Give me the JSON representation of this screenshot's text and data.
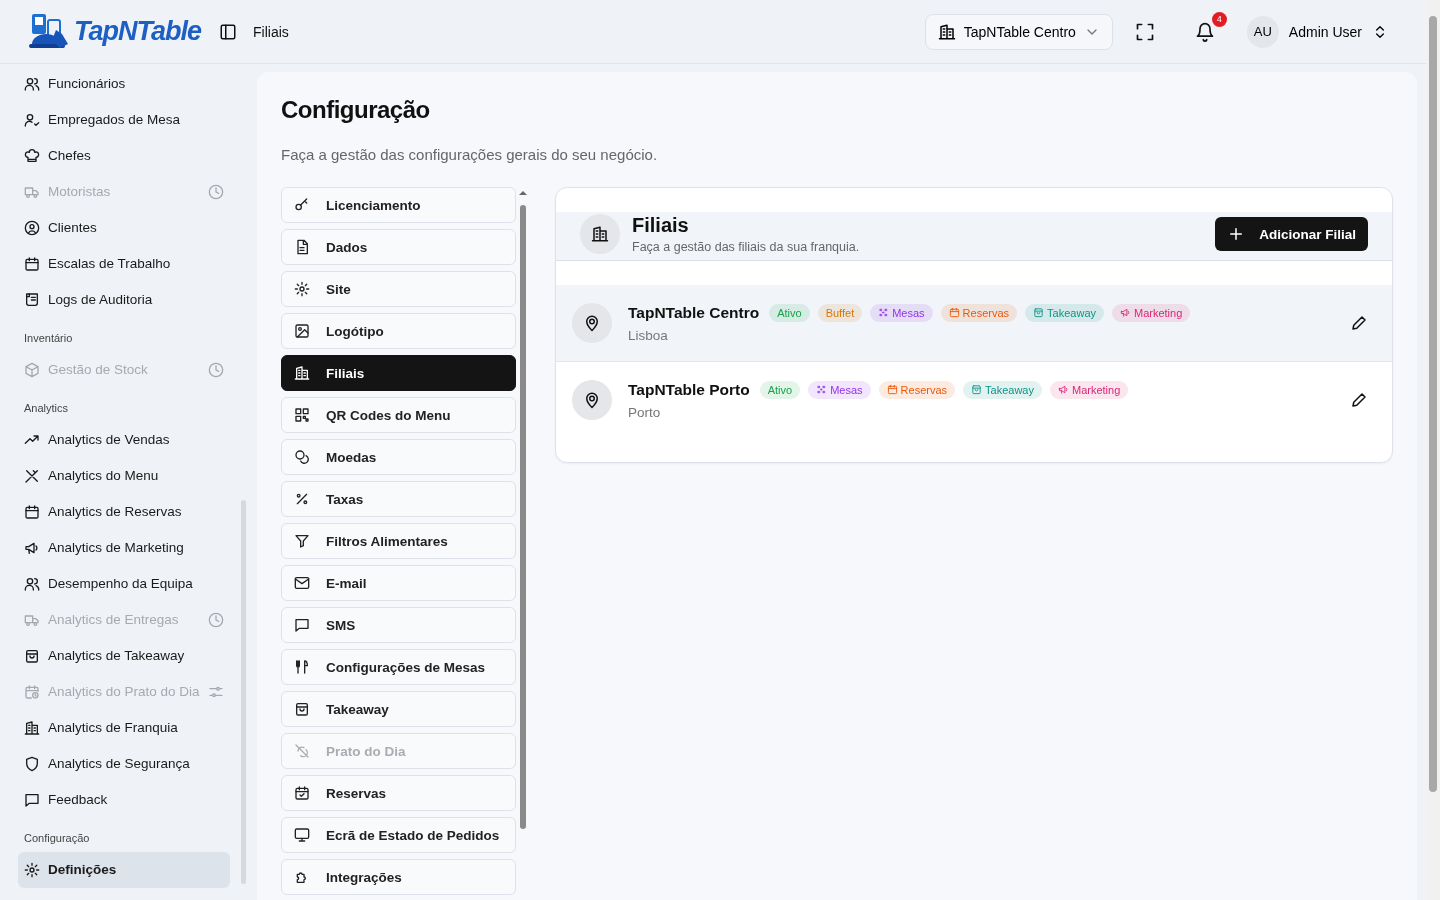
{
  "header": {
    "logo": "TapNTable",
    "page": "Filiais",
    "branch_select": {
      "value": "TapNTable Centro"
    },
    "notifications": {
      "count": "4"
    },
    "user": {
      "initials": "AU",
      "name": "Admin User"
    }
  },
  "sidebar": {
    "sections": [
      {
        "items": [
          {
            "label": "Funcionários",
            "kind": "link",
            "disabled": false,
            "selected": false
          },
          {
            "label": "Empregados de Mesa",
            "kind": "link",
            "disabled": false,
            "selected": false
          },
          {
            "label": "Chefes",
            "kind": "link",
            "disabled": false,
            "selected": false
          },
          {
            "label": "Motoristas",
            "kind": "soon",
            "disabled": true,
            "selected": false
          },
          {
            "label": "Clientes",
            "kind": "link",
            "disabled": false,
            "selected": false
          },
          {
            "label": "Escalas de Trabalho",
            "kind": "link",
            "disabled": false,
            "selected": false
          },
          {
            "label": "Logs de Auditoria",
            "kind": "link",
            "disabled": false,
            "selected": false
          }
        ]
      },
      {
        "heading": "Inventário",
        "items": [
          {
            "label": "Gestão de Stock",
            "kind": "soon",
            "disabled": true,
            "selected": false
          }
        ]
      },
      {
        "heading": "Analytics",
        "items": [
          {
            "label": "Analytics de Vendas",
            "kind": "link",
            "disabled": false,
            "selected": false
          },
          {
            "label": "Analytics do Menu",
            "kind": "link",
            "disabled": false,
            "selected": false
          },
          {
            "label": "Analytics de Reservas",
            "kind": "link",
            "disabled": false,
            "selected": false
          },
          {
            "label": "Analytics de Marketing",
            "kind": "link",
            "disabled": false,
            "selected": false
          },
          {
            "label": "Desempenho da Equipa",
            "kind": "link",
            "disabled": false,
            "selected": false
          },
          {
            "label": "Analytics de Entregas",
            "kind": "soon",
            "disabled": true,
            "selected": false
          },
          {
            "label": "Analytics de Takeaway",
            "kind": "link",
            "disabled": false,
            "selected": false
          },
          {
            "label": "Analytics do Prato do Dia",
            "kind": "setup",
            "disabled": true,
            "selected": false
          },
          {
            "label": "Analytics de Franquia",
            "kind": "link",
            "disabled": false,
            "selected": false
          },
          {
            "label": "Analytics de Segurança",
            "kind": "link",
            "disabled": false,
            "selected": false
          },
          {
            "label": "Feedback",
            "kind": "link",
            "disabled": false,
            "selected": false
          }
        ]
      },
      {
        "heading": "Configuração",
        "items": [
          {
            "label": "Definições",
            "kind": "link",
            "disabled": false,
            "selected": true
          }
        ]
      }
    ]
  },
  "page": {
    "title": "Configuração",
    "subtitle": "Faça a gestão das configurações gerais do seu negócio."
  },
  "settings_menu": [
    {
      "label": "Licenciamento",
      "selected": false,
      "disabled": false
    },
    {
      "label": "Dados",
      "selected": false,
      "disabled": false
    },
    {
      "label": "Site",
      "selected": false,
      "disabled": false
    },
    {
      "label": "Logótipo",
      "selected": false,
      "disabled": false
    },
    {
      "label": "Filiais",
      "selected": true,
      "disabled": false
    },
    {
      "label": "QR Codes do Menu",
      "selected": false,
      "disabled": false
    },
    {
      "label": "Moedas",
      "selected": false,
      "disabled": false
    },
    {
      "label": "Taxas",
      "selected": false,
      "disabled": false
    },
    {
      "label": "Filtros Alimentares",
      "selected": false,
      "disabled": false
    },
    {
      "label": "E-mail",
      "selected": false,
      "disabled": false
    },
    {
      "label": "SMS",
      "selected": false,
      "disabled": false
    },
    {
      "label": "Configurações de Mesas",
      "selected": false,
      "disabled": false
    },
    {
      "label": "Takeaway",
      "selected": false,
      "disabled": false
    },
    {
      "label": "Prato do Dia",
      "selected": false,
      "disabled": true
    },
    {
      "label": "Reservas",
      "selected": false,
      "disabled": false
    },
    {
      "label": "Ecrã de Estado de Pedidos",
      "selected": false,
      "disabled": false
    },
    {
      "label": "Integrações",
      "selected": false,
      "disabled": false
    }
  ],
  "branches": {
    "title": "Filiais",
    "subtitle": "Faça a gestão das filiais da sua franquia.",
    "add_button": "Adicionar Filial",
    "rows": [
      {
        "name": "TapNTable Centro",
        "city": "Lisboa",
        "highlighted": true,
        "tags": [
          {
            "label": "Ativo",
            "kind": "status",
            "color": "#16a34a"
          },
          {
            "label": "Buffet",
            "kind": "buffet",
            "color": "#d97706"
          },
          {
            "label": "Mesas",
            "kind": "tables",
            "color": "#9333ea"
          },
          {
            "label": "Reservas",
            "kind": "reservations",
            "color": "#ea580c"
          },
          {
            "label": "Takeaway",
            "kind": "takeaway",
            "color": "#0d9488"
          },
          {
            "label": "Marketing",
            "kind": "marketing",
            "color": "#db2777"
          }
        ]
      },
      {
        "name": "TapNTable Porto",
        "city": "Porto",
        "highlighted": false,
        "tags": [
          {
            "label": "Ativo",
            "kind": "status",
            "color": "#16a34a"
          },
          {
            "label": "Mesas",
            "kind": "tables",
            "color": "#9333ea"
          },
          {
            "label": "Reservas",
            "kind": "reservations",
            "color": "#ea580c"
          },
          {
            "label": "Takeaway",
            "kind": "takeaway",
            "color": "#0d9488"
          },
          {
            "label": "Marketing",
            "kind": "marketing",
            "color": "#db2777"
          }
        ]
      }
    ]
  }
}
